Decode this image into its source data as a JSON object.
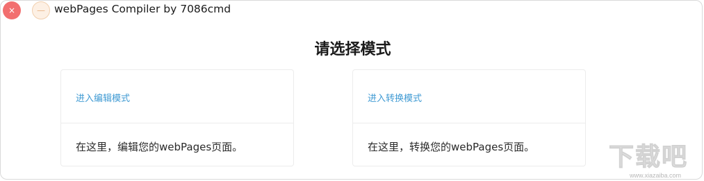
{
  "window": {
    "title": "webPages Compiler by 7086cmd",
    "close_glyph": "×",
    "minimize_glyph": "—"
  },
  "main": {
    "heading": "请选择模式"
  },
  "cards": [
    {
      "link": "进入编辑模式",
      "description": "在这里，编辑您的webPages页面。"
    },
    {
      "link": "进入转换模式",
      "description": "在这里，转换您的webPages页面。"
    }
  ],
  "watermark": {
    "text": "下载吧",
    "url": "www.xiazaiba.com"
  },
  "colors": {
    "close": "#f26f6f",
    "minimize": "#fdf0e4",
    "link": "#3f9ad3",
    "border": "#ececec"
  },
  "icons": {
    "close": "close-icon",
    "minimize": "minimize-icon"
  }
}
